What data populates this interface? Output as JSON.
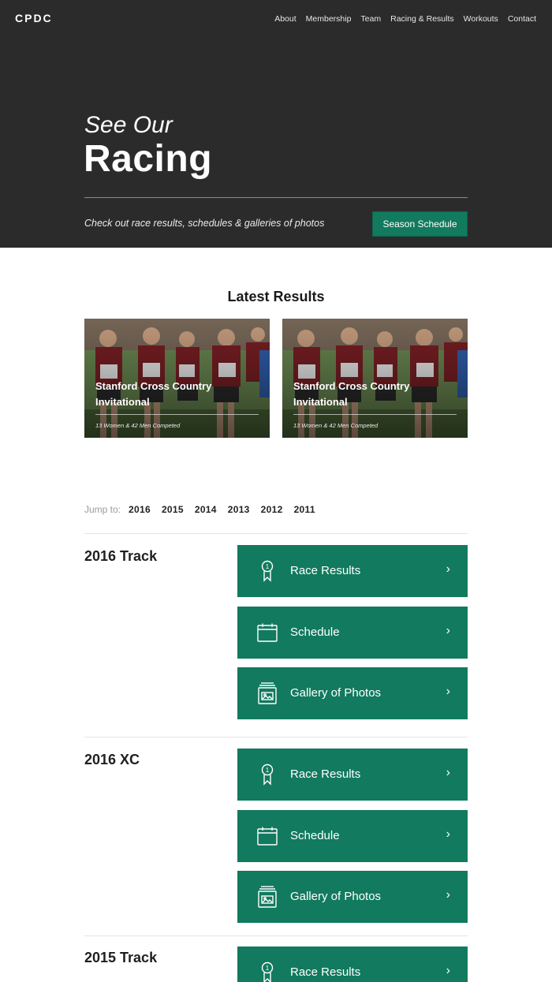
{
  "brand": {
    "logo": "CPDC",
    "accent": "#127a5e",
    "hero_bg": "#2b2b2b"
  },
  "nav": {
    "items": [
      "About",
      "Membership",
      "Team",
      "Racing & Results",
      "Workouts",
      "Contact"
    ]
  },
  "hero": {
    "subtitle": "See Our",
    "title": "Racing",
    "description": "Check out race results, schedules & galleries of photos",
    "button": "Season Schedule"
  },
  "latest": {
    "heading": "Latest Results",
    "cards": [
      {
        "title": "Stanford Cross Country Invitational",
        "meta": "13 Women & 42 Men Competed"
      },
      {
        "title": "Stanford Cross Country Invitational",
        "meta": "13 Women & 42 Men Competed"
      }
    ]
  },
  "jump": {
    "label": "Jump to:",
    "years": [
      "2016",
      "2015",
      "2014",
      "2013",
      "2012",
      "2011"
    ]
  },
  "seasons": [
    {
      "title": "2016 Track",
      "buttons": [
        {
          "label": "Race Results",
          "icon": "ribbon-icon"
        },
        {
          "label": "Schedule",
          "icon": "calendar-icon"
        },
        {
          "label": "Gallery of Photos",
          "icon": "photo-gallery-icon"
        }
      ]
    },
    {
      "title": "2016 XC",
      "buttons": [
        {
          "label": "Race Results",
          "icon": "ribbon-icon"
        },
        {
          "label": "Schedule",
          "icon": "calendar-icon"
        },
        {
          "label": "Gallery of Photos",
          "icon": "photo-gallery-icon"
        }
      ]
    },
    {
      "title": "2015 Track",
      "buttons": [
        {
          "label": "Race Results",
          "icon": "ribbon-icon"
        }
      ]
    }
  ]
}
